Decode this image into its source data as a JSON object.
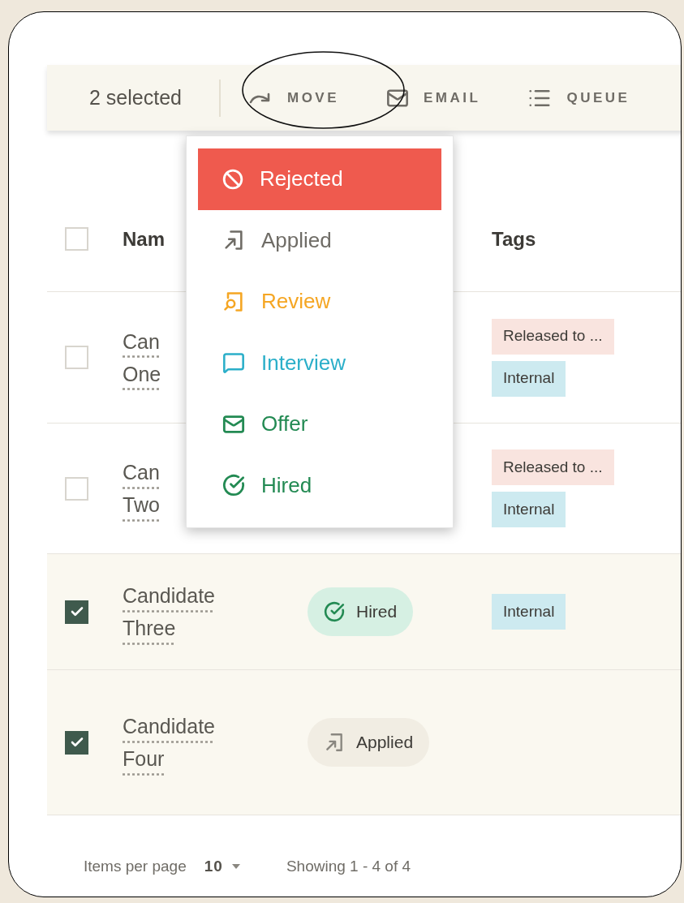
{
  "toolbar": {
    "selection_count": "2 selected",
    "actions": [
      {
        "kind": "move",
        "label": "MOVE"
      },
      {
        "kind": "email",
        "label": "EMAIL"
      },
      {
        "kind": "queue",
        "label": "QUEUE"
      }
    ]
  },
  "move_menu": {
    "items": [
      {
        "kind": "rejected",
        "label": "Rejected",
        "color": "#ef5a4e",
        "selected": true
      },
      {
        "kind": "applied",
        "label": "Applied",
        "color": "#6f6c66",
        "selected": false
      },
      {
        "kind": "review",
        "label": "Review",
        "color": "#f5a623",
        "selected": false
      },
      {
        "kind": "interview",
        "label": "Interview",
        "color": "#2bafc9",
        "selected": false
      },
      {
        "kind": "offer",
        "label": "Offer",
        "color": "#238a53",
        "selected": false
      },
      {
        "kind": "hired",
        "label": "Hired",
        "color": "#238a53",
        "selected": false
      }
    ]
  },
  "table": {
    "header_checkbox": {
      "checked": false
    },
    "columns": {
      "name": "Nam",
      "tags": "Tags"
    },
    "rows": [
      {
        "checked": false,
        "name": "Can One",
        "tags": [
          {
            "label": "Released to ...",
            "color": "#f9e4df"
          },
          {
            "label": "Internal",
            "color": "#cdeaf0"
          }
        ]
      },
      {
        "checked": false,
        "name": "Can Two",
        "tags": [
          {
            "label": "Released to ...",
            "color": "#f9e4df"
          },
          {
            "label": "Internal",
            "color": "#cdeaf0"
          }
        ]
      },
      {
        "checked": true,
        "name": "Candidate Three",
        "status": {
          "kind": "hired",
          "label": "Hired"
        },
        "tags": [
          {
            "label": "Internal",
            "color": "#cdeaf0"
          }
        ]
      },
      {
        "checked": true,
        "name": "Candidate Four",
        "status": {
          "kind": "applied",
          "label": "Applied"
        },
        "tags": []
      }
    ]
  },
  "footer": {
    "items_per_page_label": "Items per page",
    "items_per_page": "10",
    "range": "Showing 1 - 4 of 4"
  }
}
